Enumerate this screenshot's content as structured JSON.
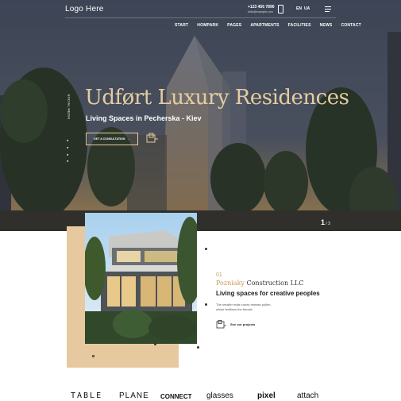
{
  "header": {
    "logo": "Logo Here",
    "phone": "+123 456 7890",
    "email": "hello@example.com",
    "languages": [
      "EN",
      "UA"
    ]
  },
  "nav": {
    "items": [
      "START",
      "HOMPARK",
      "PAGES",
      "APARTMENTS",
      "FACILITIES",
      "NEWS",
      "CONTACT"
    ]
  },
  "hero": {
    "social_label": "SOCIAL MEDIA",
    "social_icons": [
      "twitter-icon",
      "facebook-icon",
      "pinterest-icon",
      "instagram-icon"
    ],
    "title": "Udført Luxury Residences",
    "subtitle": "Living Spaces in Pecherska - Kiev",
    "cta_label": "GET A CONSULTATION",
    "cta_arrow": "→",
    "slide_current": "1",
    "slide_total": "/ 3"
  },
  "about": {
    "number": "01",
    "company_accent": "Pozniaky",
    "company_rest": " Construction LLC",
    "tagline": "Living spaces for creative peoples",
    "description": "The smaller male cones release pollen, which fertilizes the female",
    "link_label": "See our projects"
  },
  "brands": [
    "TABLE",
    "PLANE",
    "CONNECT",
    "glasses",
    "pixel",
    "attach"
  ],
  "colors": {
    "accent_gold": "#e3cda0",
    "block_gold": "#e7c99f"
  }
}
